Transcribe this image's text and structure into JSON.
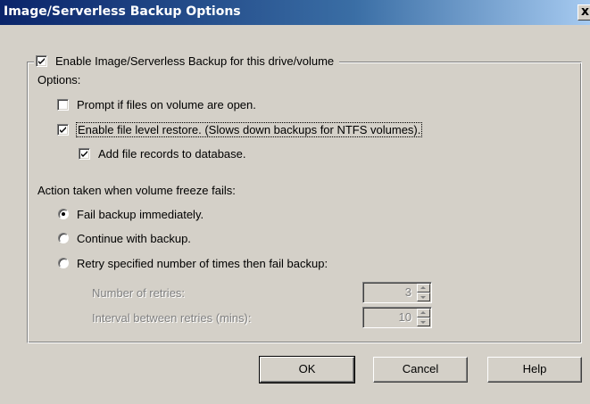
{
  "window": {
    "title": "Image/Serverless Backup Options",
    "close_glyph": "x"
  },
  "group": {
    "enable_checkbox": {
      "label": "Enable Image/Serverless Backup for this drive/volume",
      "checked": true
    }
  },
  "options": {
    "heading": "Options:",
    "prompt_open_files": {
      "label": "Prompt if files on volume are open.",
      "checked": false
    },
    "file_level_restore": {
      "label": "Enable file level restore. (Slows down backups for NTFS volumes).",
      "checked": true
    },
    "add_file_records": {
      "label": "Add file records to database.",
      "checked": true
    }
  },
  "freeze_action": {
    "heading": "Action taken when volume freeze fails:",
    "fail_immediately": {
      "label": "Fail backup immediately.",
      "selected": true
    },
    "continue_backup": {
      "label": "Continue with backup.",
      "selected": false
    },
    "retry": {
      "label": "Retry specified number of times then fail backup:",
      "selected": false
    },
    "retries": {
      "label": "Number of retries:",
      "value": "3"
    },
    "interval": {
      "label": "Interval between retries (mins):",
      "value": "10"
    }
  },
  "buttons": {
    "ok": "OK",
    "cancel": "Cancel",
    "help": "Help"
  },
  "colors": {
    "title_bar": "#0a246a",
    "dialog_face": "#d4d0c8",
    "disabled_text": "#808080"
  },
  "icons": {
    "checkmark": "checkmark-icon",
    "radio_dot": "radio-dot-icon",
    "spin_up": "spin-up-arrow-icon",
    "spin_down": "spin-down-arrow-icon"
  }
}
